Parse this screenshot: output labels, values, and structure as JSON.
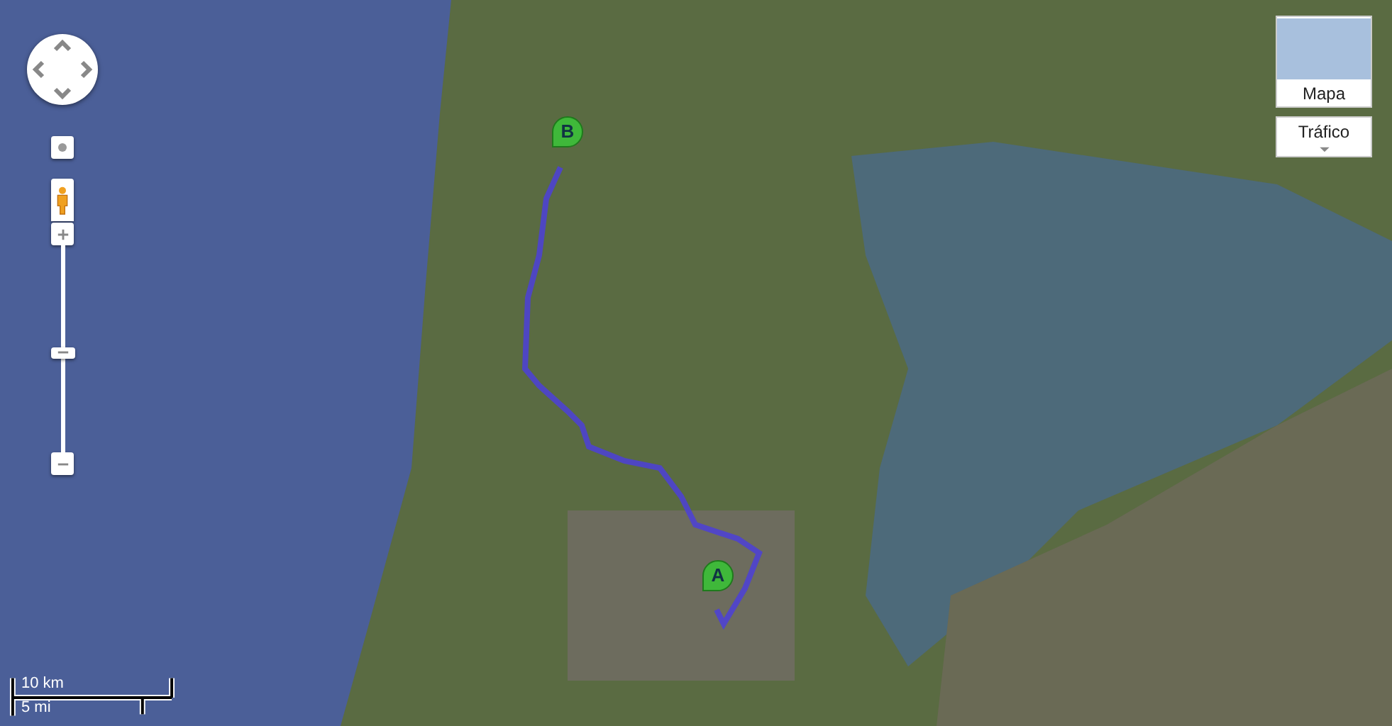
{
  "map_type_buttons": [
    {
      "label": "Mapa",
      "selected": false
    }
  ],
  "traffic_button": {
    "label": "Tráfico"
  },
  "zoom": {
    "level": 0.48
  },
  "route": {
    "markers": [
      {
        "label": "A"
      },
      {
        "label": "B"
      }
    ]
  },
  "scale": {
    "metric": "10 km",
    "imperial": "5 mi"
  }
}
